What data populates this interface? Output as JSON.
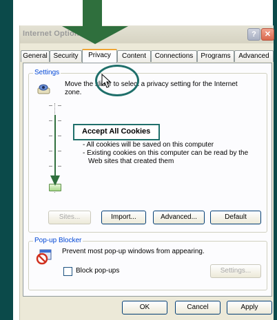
{
  "window": {
    "title": "Internet Options"
  },
  "tabs": [
    {
      "label": "General"
    },
    {
      "label": "Security"
    },
    {
      "label": "Privacy"
    },
    {
      "label": "Content"
    },
    {
      "label": "Connections"
    },
    {
      "label": "Programs"
    },
    {
      "label": "Advanced"
    }
  ],
  "settings": {
    "group_label": "Settings",
    "intro": "Move the slider to select a privacy setting for the Internet zone.",
    "level_title": "Accept All Cookies",
    "bullets": [
      "- All cookies will be saved on this computer",
      "- Existing cookies on this computer can be read by the",
      "  Web sites that created them"
    ],
    "buttons": {
      "sites": "Sites...",
      "import": "Import...",
      "advanced": "Advanced...",
      "default": "Default"
    }
  },
  "popup": {
    "group_label": "Pop-up Blocker",
    "description": "Prevent most pop-up windows from appearing.",
    "checkbox_label": "Block pop-ups",
    "checkbox_checked": false,
    "settings_button": "Settings..."
  },
  "footer": {
    "ok": "OK",
    "cancel": "Cancel",
    "apply": "Apply"
  },
  "icons": [
    "help-icon",
    "close-icon",
    "privacy-eye-icon",
    "popup-blocker-icon",
    "cursor-icon",
    "down-arrow-icon"
  ],
  "colors": {
    "frame": "#0b4a4a",
    "annotation": "#1f6f6a",
    "arrow": "#2f6f3d",
    "group_label": "#0046d5"
  }
}
